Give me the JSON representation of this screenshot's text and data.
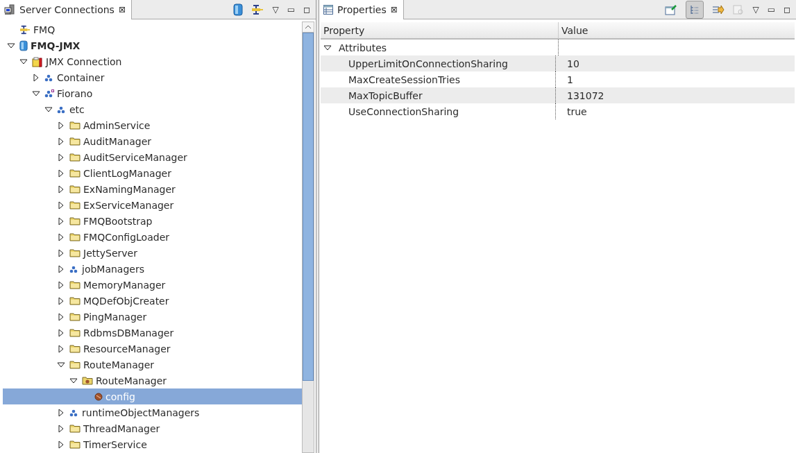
{
  "left_view": {
    "tab": {
      "title": "Server Connections",
      "close": "⊠"
    },
    "toolbar": {
      "menu": "▽",
      "minimize": "▭",
      "maximize": "◻"
    }
  },
  "tree": [
    {
      "label": "FMQ",
      "kind": "plug",
      "selected": false
    },
    {
      "label": "FMQ-JMX",
      "kind": "server",
      "expanded": true,
      "selected": false,
      "children": [
        {
          "label": "JMX Connection",
          "kind": "toolbox",
          "expanded": true,
          "selected": false,
          "children": [
            {
              "label": "Container",
              "kind": "beans",
              "expanded": false,
              "selected": false
            },
            {
              "label": "Fiorano",
              "kind": "beans-marked",
              "expanded": true,
              "selected": false,
              "children": [
                {
                  "label": "etc",
                  "kind": "beans",
                  "expanded": true,
                  "selected": false,
                  "children": [
                    {
                      "label": "AdminService",
                      "kind": "folder",
                      "expanded": false,
                      "selected": false
                    },
                    {
                      "label": "AuditManager",
                      "kind": "folder",
                      "expanded": false,
                      "selected": false
                    },
                    {
                      "label": "AuditServiceManager",
                      "kind": "folder",
                      "expanded": false,
                      "selected": false
                    },
                    {
                      "label": "ClientLogManager",
                      "kind": "folder",
                      "expanded": false,
                      "selected": false
                    },
                    {
                      "label": "ExNamingManager",
                      "kind": "folder",
                      "expanded": false,
                      "selected": false
                    },
                    {
                      "label": "ExServiceManager",
                      "kind": "folder",
                      "expanded": false,
                      "selected": false
                    },
                    {
                      "label": "FMQBootstrap",
                      "kind": "folder",
                      "expanded": false,
                      "selected": false
                    },
                    {
                      "label": "FMQConfigLoader",
                      "kind": "folder",
                      "expanded": false,
                      "selected": false
                    },
                    {
                      "label": "JettyServer",
                      "kind": "folder",
                      "expanded": false,
                      "selected": false
                    },
                    {
                      "label": "jobManagers",
                      "kind": "beans",
                      "expanded": false,
                      "selected": false
                    },
                    {
                      "label": "MemoryManager",
                      "kind": "folder",
                      "expanded": false,
                      "selected": false
                    },
                    {
                      "label": "MQDefObjCreater",
                      "kind": "folder",
                      "expanded": false,
                      "selected": false
                    },
                    {
                      "label": "PingManager",
                      "kind": "folder",
                      "expanded": false,
                      "selected": false
                    },
                    {
                      "label": "RdbmsDBManager",
                      "kind": "folder",
                      "expanded": false,
                      "selected": false
                    },
                    {
                      "label": "ResourceManager",
                      "kind": "folder",
                      "expanded": false,
                      "selected": false
                    },
                    {
                      "label": "RouteManager",
                      "kind": "folder",
                      "expanded": true,
                      "selected": false,
                      "children": [
                        {
                          "label": "RouteManager",
                          "kind": "folder-bean",
                          "expanded": true,
                          "selected": false,
                          "children": [
                            {
                              "label": "config",
                              "kind": "bean",
                              "selected": true
                            }
                          ]
                        }
                      ]
                    },
                    {
                      "label": "runtimeObjectManagers",
                      "kind": "beans",
                      "expanded": false,
                      "selected": false
                    },
                    {
                      "label": "ThreadManager",
                      "kind": "folder",
                      "expanded": false,
                      "selected": false
                    },
                    {
                      "label": "TimerService",
                      "kind": "folder",
                      "expanded": false,
                      "selected": false
                    }
                  ]
                }
              ]
            }
          ]
        }
      ]
    }
  ],
  "right_view": {
    "tab": {
      "title": "Properties",
      "close": "⊠"
    },
    "toolbar": {
      "menu": "▽",
      "minimize": "▭",
      "maximize": "◻"
    }
  },
  "properties": {
    "columns": [
      "Property",
      "Value"
    ],
    "category": {
      "label": "Attributes",
      "expanded": true
    },
    "rows": [
      {
        "property": "UpperLimitOnConnectionSharing",
        "value": "10"
      },
      {
        "property": "MaxCreateSessionTries",
        "value": "1"
      },
      {
        "property": "MaxTopicBuffer",
        "value": "131072"
      },
      {
        "property": "UseConnectionSharing",
        "value": "true"
      }
    ]
  }
}
